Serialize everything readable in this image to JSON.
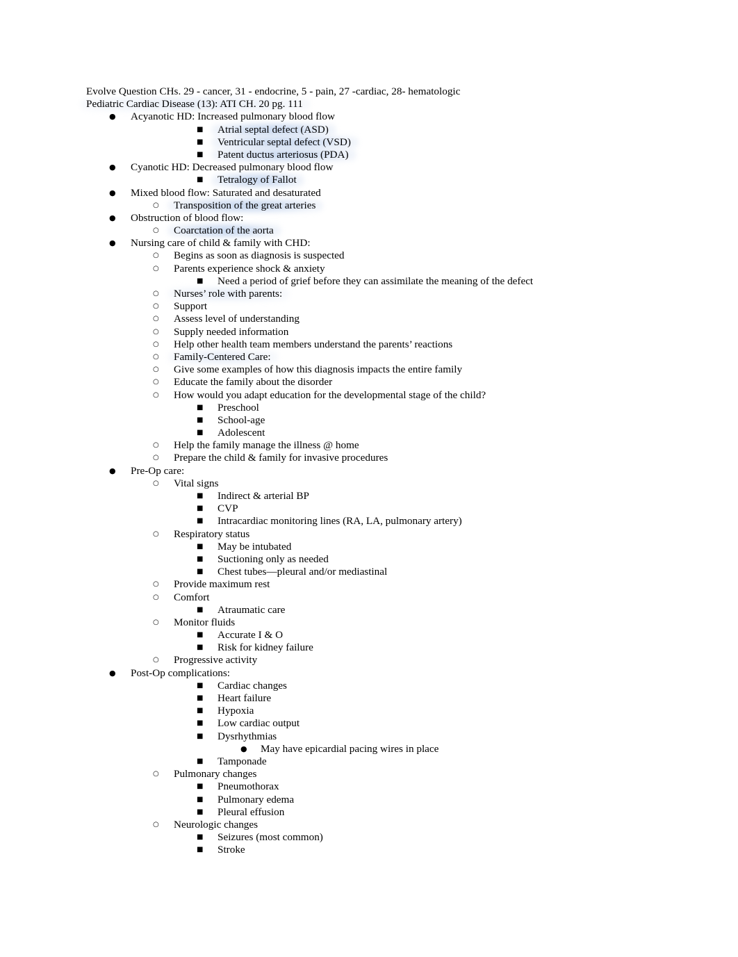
{
  "document": {
    "header_lines": [
      {
        "id": "header-course-chapters",
        "text": "Evolve Question CHs. 29 - cancer, 31 - endocrine, 5 - pain, 27 -cardiac, 28- hematologic",
        "highlight": "none"
      },
      {
        "id": "header-topic",
        "text": "Pediatric Cardiac Disease (13): ATI CH. 20 pg. 111",
        "highlight": "soft"
      }
    ],
    "bullet_glyphs": {
      "disc": "●",
      "circle": "○",
      "square": "■"
    },
    "highlight_color": "#c4d5ee",
    "outline": [
      {
        "level": "lvl1",
        "glyph": "disc",
        "text": "Acyanotic HD: Increased pulmonary blood flow",
        "highlight": "none"
      },
      {
        "level": "lvl2s",
        "glyph": "square",
        "text": "Atrial septal defect (ASD)",
        "highlight": "strong"
      },
      {
        "level": "lvl2s",
        "glyph": "square",
        "text": "Ventricular septal defect (VSD)",
        "highlight": "strong"
      },
      {
        "level": "lvl2s",
        "glyph": "square",
        "text": "Patent ductus arteriosus (PDA)",
        "highlight": "strong"
      },
      {
        "level": "lvl1",
        "glyph": "disc",
        "text": "Cyanotic HD: Decreased pulmonary blood flow",
        "highlight": "none"
      },
      {
        "level": "lvl2s",
        "glyph": "square",
        "text": "Tetralogy of Fallot",
        "highlight": "strong"
      },
      {
        "level": "lvl1",
        "glyph": "disc",
        "text": "Mixed blood flow: Saturated and desaturated",
        "highlight": "none"
      },
      {
        "level": "lvl2c",
        "glyph": "circle",
        "text": "Transposition of the great arteries",
        "highlight": "strong"
      },
      {
        "level": "lvl1",
        "glyph": "disc",
        "text": "Obstruction of blood flow:",
        "highlight": "none"
      },
      {
        "level": "lvl2c",
        "glyph": "circle",
        "text": "Coarctation of the aorta",
        "highlight": "strong"
      },
      {
        "level": "lvl1",
        "glyph": "disc",
        "text": "Nursing care of child & family with CHD:",
        "highlight": "none"
      },
      {
        "level": "lvl2c",
        "glyph": "circle",
        "text": "Begins as soon as diagnosis is suspected",
        "highlight": "none"
      },
      {
        "level": "lvl2c",
        "glyph": "circle",
        "text": "Parents experience shock & anxiety",
        "highlight": "none"
      },
      {
        "level": "lvl2s",
        "glyph": "square",
        "text": "Need a period of grief before they can assimilate the meaning of the defect",
        "highlight": "none"
      },
      {
        "level": "lvl2c",
        "glyph": "circle",
        "text": "Nurses’ role with parents:",
        "highlight": "soft"
      },
      {
        "level": "lvl2c",
        "glyph": "circle",
        "text": "Support",
        "highlight": "none"
      },
      {
        "level": "lvl2c",
        "glyph": "circle",
        "text": "Assess level of understanding",
        "highlight": "none"
      },
      {
        "level": "lvl2c",
        "glyph": "circle",
        "text": "Supply needed information",
        "highlight": "none"
      },
      {
        "level": "lvl2c",
        "glyph": "circle",
        "text": "Help other health team members understand the parents’ reactions",
        "highlight": "none"
      },
      {
        "level": "lvl2c",
        "glyph": "circle",
        "text": "Family-Centered Care:",
        "highlight": "soft"
      },
      {
        "level": "lvl2c",
        "glyph": "circle",
        "text": "Give some examples of how this diagnosis impacts the entire family",
        "highlight": "none"
      },
      {
        "level": "lvl2c",
        "glyph": "circle",
        "text": "Educate the family about the disorder",
        "highlight": "none"
      },
      {
        "level": "lvl2c",
        "glyph": "circle",
        "text": "How would you adapt education for the developmental stage of the child?",
        "highlight": "none"
      },
      {
        "level": "lvl2s",
        "glyph": "square",
        "text": "Preschool",
        "highlight": "none"
      },
      {
        "level": "lvl2s",
        "glyph": "square",
        "text": "School-age",
        "highlight": "none"
      },
      {
        "level": "lvl2s",
        "glyph": "square",
        "text": "Adolescent",
        "highlight": "none"
      },
      {
        "level": "lvl2c",
        "glyph": "circle",
        "text": "Help the family manage the illness @ home",
        "highlight": "none"
      },
      {
        "level": "lvl2c",
        "glyph": "circle",
        "text": "Prepare the child & family for invasive procedures",
        "highlight": "none"
      },
      {
        "level": "lvl1",
        "glyph": "disc",
        "text": "Pre-Op care:",
        "highlight": "none"
      },
      {
        "level": "lvl2c",
        "glyph": "circle",
        "text": "Vital signs",
        "highlight": "none"
      },
      {
        "level": "lvl2s",
        "glyph": "square",
        "text": "Indirect & arterial BP",
        "highlight": "none"
      },
      {
        "level": "lvl2s",
        "glyph": "square",
        "text": "CVP",
        "highlight": "none"
      },
      {
        "level": "lvl2s",
        "glyph": "square",
        "text": "Intracardiac monitoring lines (RA, LA, pulmonary artery)",
        "highlight": "none"
      },
      {
        "level": "lvl2c",
        "glyph": "circle",
        "text": "Respiratory status",
        "highlight": "none"
      },
      {
        "level": "lvl2s",
        "glyph": "square",
        "text": "May be intubated",
        "highlight": "none"
      },
      {
        "level": "lvl2s",
        "glyph": "square",
        "text": "Suctioning only as needed",
        "highlight": "none"
      },
      {
        "level": "lvl2s",
        "glyph": "square",
        "text": "Chest tubes—pleural and/or mediastinal",
        "highlight": "none"
      },
      {
        "level": "lvl2c",
        "glyph": "circle",
        "text": "Provide maximum rest",
        "highlight": "none"
      },
      {
        "level": "lvl2c",
        "glyph": "circle",
        "text": "Comfort",
        "highlight": "none"
      },
      {
        "level": "lvl2s",
        "glyph": "square",
        "text": "Atraumatic care",
        "highlight": "none"
      },
      {
        "level": "lvl2c",
        "glyph": "circle",
        "text": "Monitor fluids",
        "highlight": "none"
      },
      {
        "level": "lvl2s",
        "glyph": "square",
        "text": "Accurate I & O",
        "highlight": "none"
      },
      {
        "level": "lvl2s",
        "glyph": "square",
        "text": "Risk for kidney failure",
        "highlight": "none"
      },
      {
        "level": "lvl2c",
        "glyph": "circle",
        "text": "Progressive activity",
        "highlight": "none"
      },
      {
        "level": "lvl1",
        "glyph": "disc",
        "text": "Post-Op complications:",
        "highlight": "none"
      },
      {
        "level": "lvl2s",
        "glyph": "square",
        "text": "Cardiac changes",
        "highlight": "none"
      },
      {
        "level": "lvl2s",
        "glyph": "square",
        "text": "Heart failure",
        "highlight": "none"
      },
      {
        "level": "lvl2s",
        "glyph": "square",
        "text": "Hypoxia",
        "highlight": "none"
      },
      {
        "level": "lvl2s",
        "glyph": "square",
        "text": "Low cardiac output",
        "highlight": "none"
      },
      {
        "level": "lvl2s",
        "glyph": "square",
        "text": "Dysrhythmias",
        "highlight": "none"
      },
      {
        "level": "lvl3d",
        "glyph": "disc",
        "text": "May have epicardial pacing wires in place",
        "highlight": "none"
      },
      {
        "level": "lvl2s",
        "glyph": "square",
        "text": "Tamponade",
        "highlight": "none"
      },
      {
        "level": "lvl2c",
        "glyph": "circle",
        "text": "Pulmonary changes",
        "highlight": "none"
      },
      {
        "level": "lvl2s",
        "glyph": "square",
        "text": "Pneumothorax",
        "highlight": "none"
      },
      {
        "level": "lvl2s",
        "glyph": "square",
        "text": "Pulmonary edema",
        "highlight": "none"
      },
      {
        "level": "lvl2s",
        "glyph": "square",
        "text": "Pleural effusion",
        "highlight": "none"
      },
      {
        "level": "lvl2c",
        "glyph": "circle",
        "text": "Neurologic changes",
        "highlight": "none"
      },
      {
        "level": "lvl2s",
        "glyph": "square",
        "text": "Seizures (most common)",
        "highlight": "none"
      },
      {
        "level": "lvl2s",
        "glyph": "square",
        "text": "Stroke",
        "highlight": "none"
      }
    ]
  }
}
